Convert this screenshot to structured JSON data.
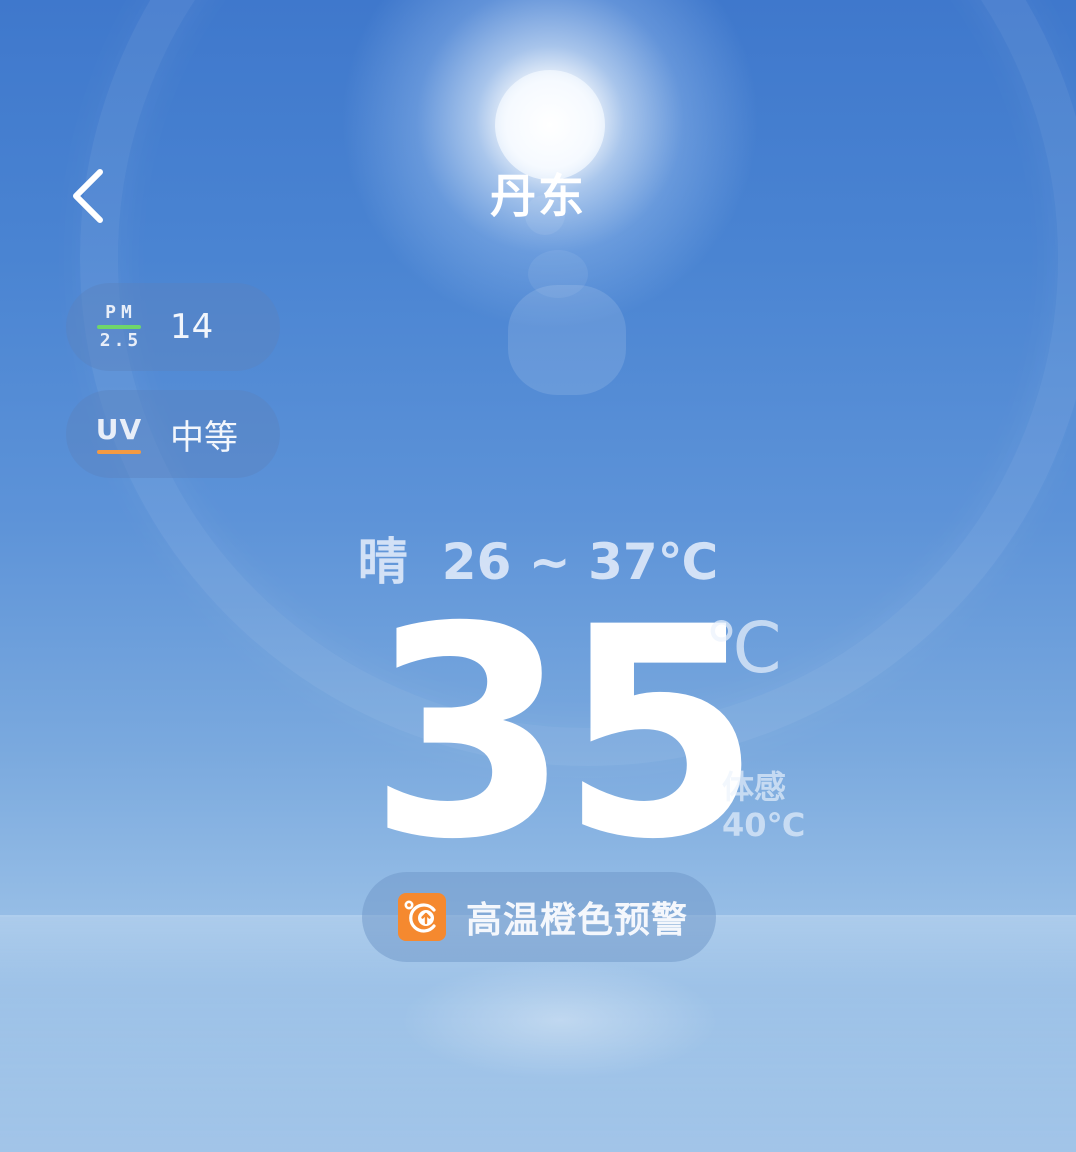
{
  "header": {
    "city": "丹东",
    "back_icon": "chevron-left-icon"
  },
  "air_quality": {
    "pm_label_top": "PM",
    "pm_label_bottom": "2.5",
    "pm_value": "14",
    "pm_bar_color": "#6fd66a",
    "uv_label": "UV",
    "uv_value": "中等",
    "uv_bar_color": "#f39a43"
  },
  "weather": {
    "condition": "晴",
    "range": "26 ~ 37℃",
    "current_temp": "35",
    "unit": "℃",
    "feels_label": "体感",
    "feels_value": "40℃"
  },
  "alert": {
    "icon": "high-temperature-warning-icon",
    "icon_color": "#f5892f",
    "text": "高温橙色预警"
  }
}
